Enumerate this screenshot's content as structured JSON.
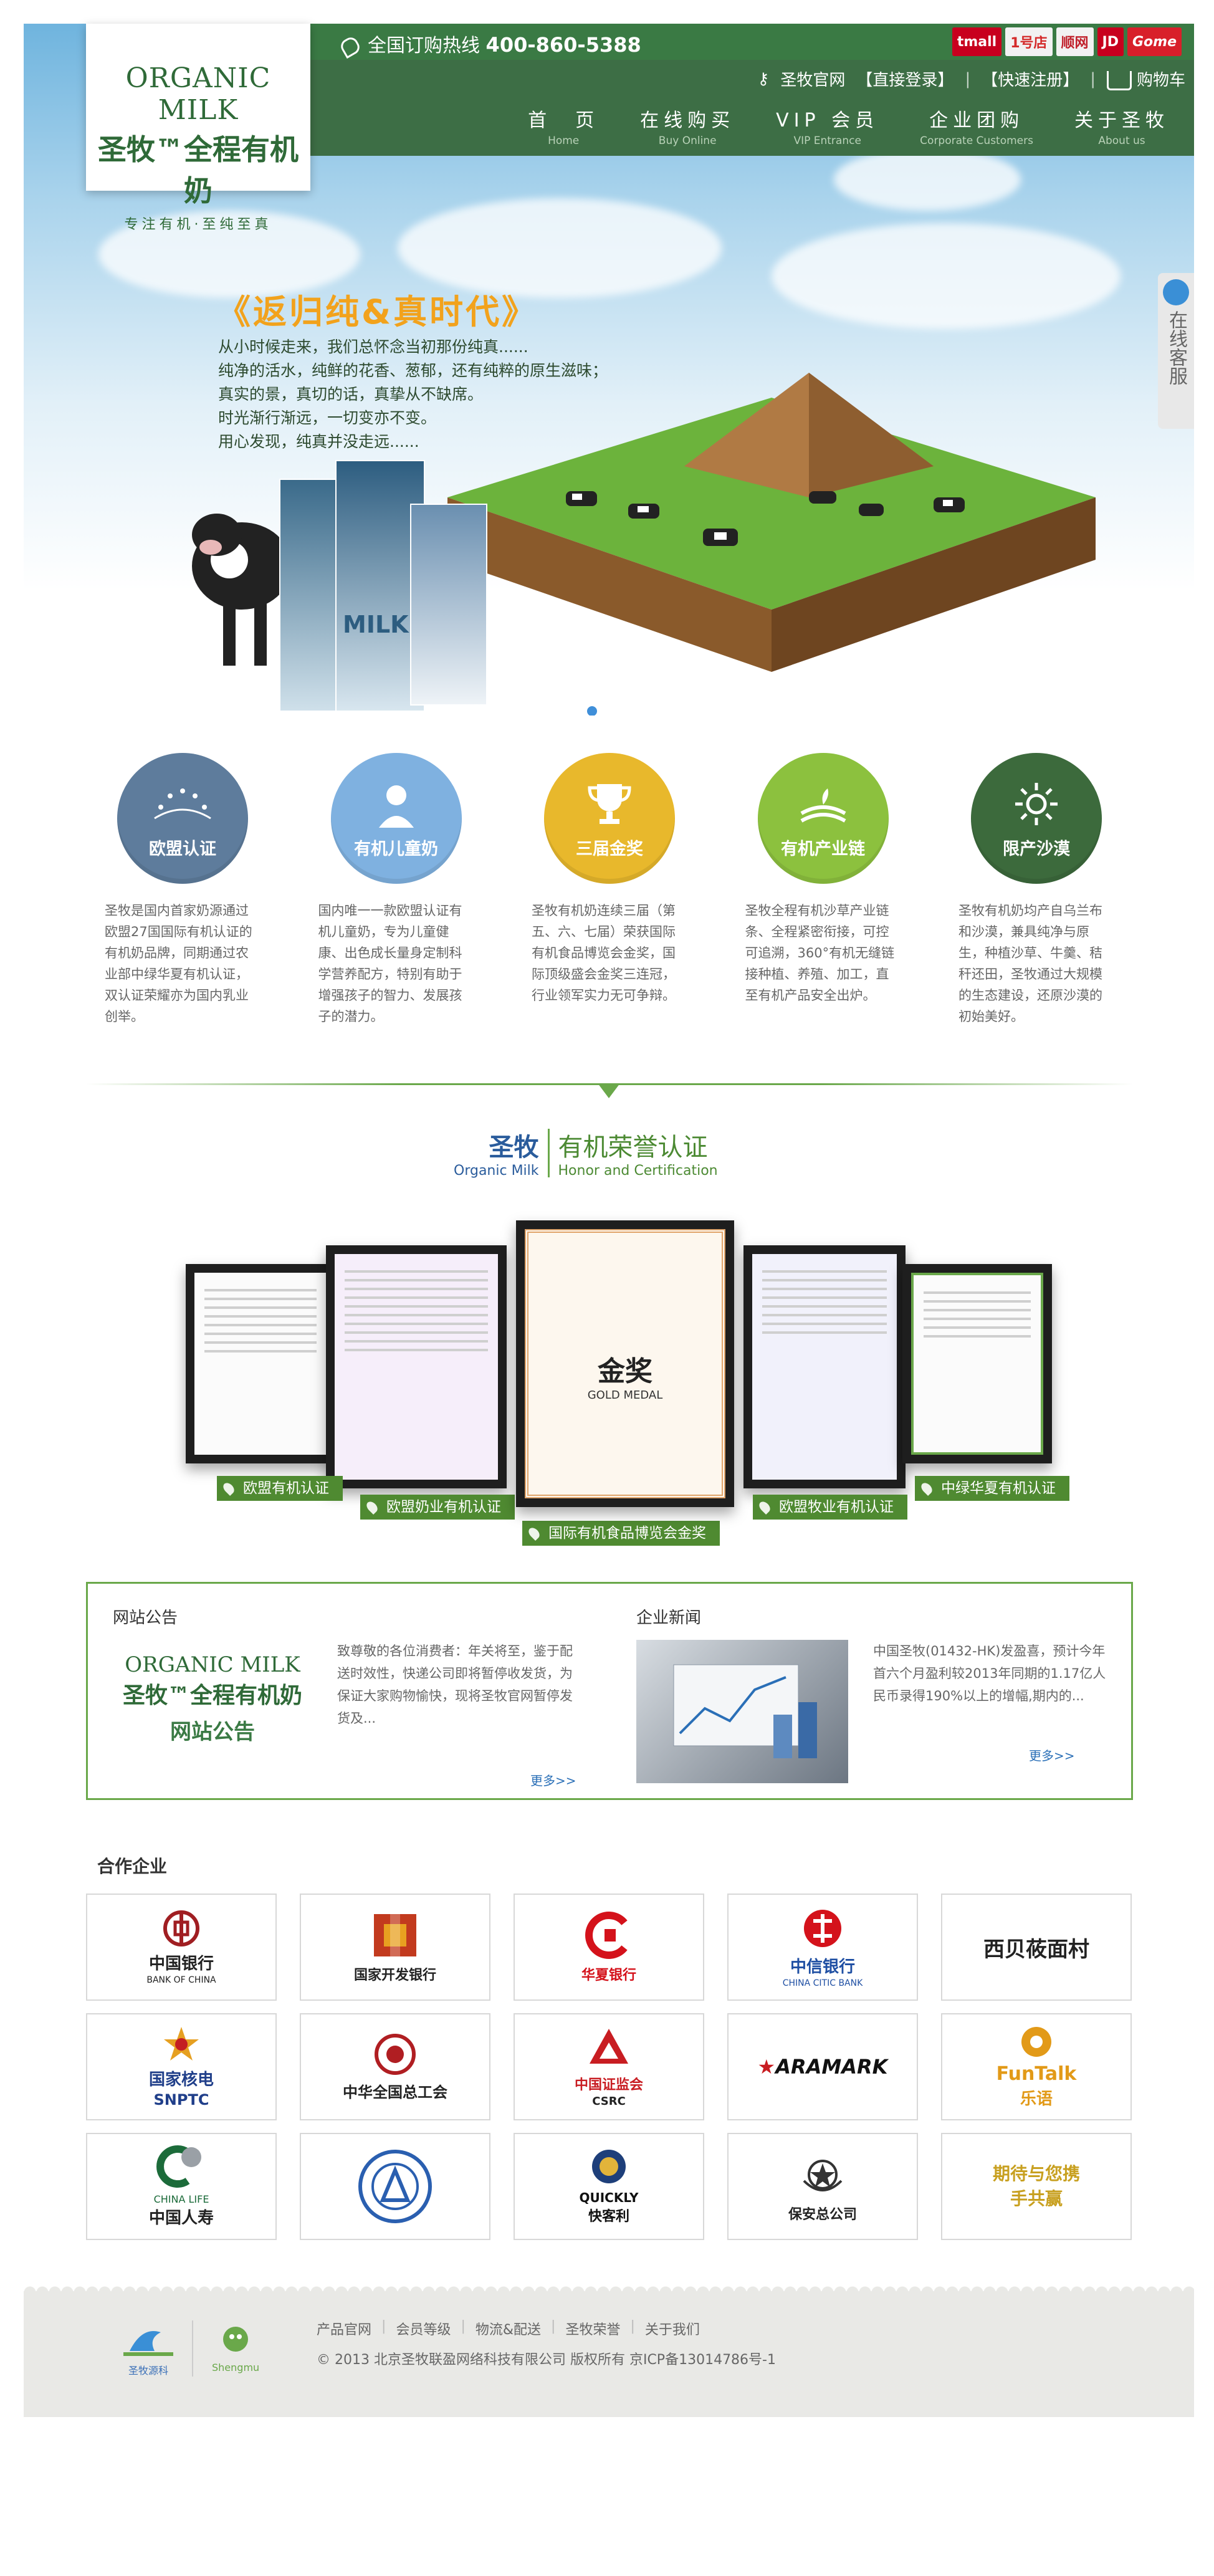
{
  "header": {
    "hotline_label": "全国订购热线",
    "hotline_number": "400-860-5388",
    "partner_logos": [
      "tmall",
      "1号店",
      "顺网",
      "JD",
      "Gome"
    ],
    "util_links": [
      "圣牧官网",
      "【直接登录】",
      "【快速注册】",
      "购物车"
    ],
    "nav": [
      {
        "cn": "首　页",
        "en": "Home"
      },
      {
        "cn": "在线购买",
        "en": "Buy Online"
      },
      {
        "cn": "VIP 会员",
        "en": "VIP Entrance"
      },
      {
        "cn": "企业团购",
        "en": "Corporate Customers"
      },
      {
        "cn": "关于圣牧",
        "en": "About us"
      }
    ]
  },
  "logo": {
    "en": "ORGANIC MILK",
    "cn": "圣牧™全程有机奶",
    "tagline": "专注有机·至纯至真"
  },
  "hero": {
    "title": "《返归纯&真时代》",
    "lines": [
      "从小时候走来，我们总怀念当初那份纯真......",
      "纯净的活水，纯鲜的花香、葱郁，还有纯粹的原生滋味；",
      "真实的景，真切的话，真挚从不缺席。",
      "时光渐行渐远，一切变亦不变。",
      "用心发现，纯真并没走远......"
    ],
    "product_label": "MILK",
    "float_service": "在线客服"
  },
  "features": [
    {
      "label": "欧盟认证",
      "color": "#5e7c9c",
      "icon": "stars-icon",
      "desc": "圣牧是国内首家奶源通过欧盟27国国际有机认证的有机奶品牌，同期通过农业部中绿华夏有机认证，双认证荣耀亦为国内乳业创举。"
    },
    {
      "label": "有机儿童奶",
      "color": "#7fb1e0",
      "icon": "child-icon",
      "desc": "国内唯一一款欧盟认证有机儿童奶，专为儿童健康、出色成长量身定制科学营养配方，特别有助于增强孩子的智力、发展孩子的潜力。"
    },
    {
      "label": "三届金奖",
      "color": "#e8b82c",
      "icon": "trophy-icon",
      "desc": "圣牧有机奶连续三届（第五、六、七届）荣获国际有机食品博览会金奖，国际顶级盛会金奖三连冠，行业领军实力无可争辩。"
    },
    {
      "label": "有机产业链",
      "color": "#8cc13e",
      "icon": "chain-icon",
      "desc": "圣牧全程有机沙草产业链条、全程紧密衔接，可控可追溯，360°有机无缝链接种植、养殖、加工，直至有机产品安全出炉。"
    },
    {
      "label": "限产沙漠",
      "color": "#3c6a3c",
      "icon": "sun-icon",
      "desc": "圣牧有机奶均产自乌兰布和沙漠，兼具纯净与原生，种植沙草、牛羹、秸秆还田，圣牧通过大规模的生态建设，还原沙漠的初始美好。"
    }
  ],
  "honor": {
    "title_cn_left": "圣牧",
    "title_en_left": "Organic Milk",
    "title_cn_right": "有机荣誉认证",
    "title_en_right": "Honor and Certification",
    "certs": [
      "欧盟有机认证",
      "欧盟奶业有机认证",
      "国际有机食品博览会金奖",
      "欧盟牧业有机认证",
      "中绿华夏有机认证"
    ],
    "gold_medal_cn": "金奖",
    "gold_medal_en": "GOLD MEDAL"
  },
  "notice": {
    "heading": "网站公告",
    "img_en": "ORGANIC MILK",
    "img_cn": "圣牧™全程有机奶",
    "img_title": "网站公告",
    "text": "致尊敬的各位消费者：年关将至，鉴于配送时效性，快递公司即将暂停收发货，为保证大家购物愉快，现将圣牧官网暂停发货及...",
    "more": "更多>>"
  },
  "news": {
    "heading": "企业新闻",
    "text": "中国圣牧(01432-HK)发盈喜，预计今年首六个月盈利较2013年同期的1.17亿人民币录得190%以上的增幅,期内的...",
    "more": "更多>>"
  },
  "partners": {
    "title": "合作企业",
    "items": [
      {
        "name": "中国银行",
        "sub": "BANK OF CHINA",
        "color": "#a01e22"
      },
      {
        "name": "国家开发银行",
        "sub": "",
        "color": "#c23a1e"
      },
      {
        "name": "华夏银行",
        "sub": "",
        "color": "#d4121b"
      },
      {
        "name": "中信银行",
        "sub": "CHINA CITIC BANK",
        "color": "#1f4fa3"
      },
      {
        "name": "西贝莜面村",
        "sub": "",
        "color": "#222222"
      },
      {
        "name": "国家核电",
        "sub": "SNPTC",
        "color": "#203f8a"
      },
      {
        "name": "中华全国总工会",
        "sub": "",
        "color": "#b01e22"
      },
      {
        "name": "中国证监会",
        "sub": "CSRC",
        "color": "#c81d22"
      },
      {
        "name": "ARAMARK",
        "sub": "",
        "color": "#111111"
      },
      {
        "name": "FunTalk",
        "sub": "乐语",
        "color": "#e29a18"
      },
      {
        "name": "中国人寿",
        "sub": "CHINA LIFE",
        "color": "#1c6b3a"
      },
      {
        "name": "",
        "sub": "",
        "color": "#2a5fb0"
      },
      {
        "name": "快客利",
        "sub": "QUICKLY",
        "color": "#1e3f7a"
      },
      {
        "name": "保安总公司",
        "sub": "",
        "color": "#333333"
      },
      {
        "name": "期待与您携手共赢",
        "sub": "",
        "color": "#c8a020"
      }
    ]
  },
  "footer": {
    "logo_left": "圣牧源科",
    "logo_right": "Shengmu",
    "links": [
      "产品官网",
      "会员等级",
      "物流&配送",
      "圣牧荣誉",
      "关于我们"
    ],
    "copyright": "© 2013 北京圣牧联盈网络科技有限公司 版权所有 京ICP备13014786号-1"
  }
}
